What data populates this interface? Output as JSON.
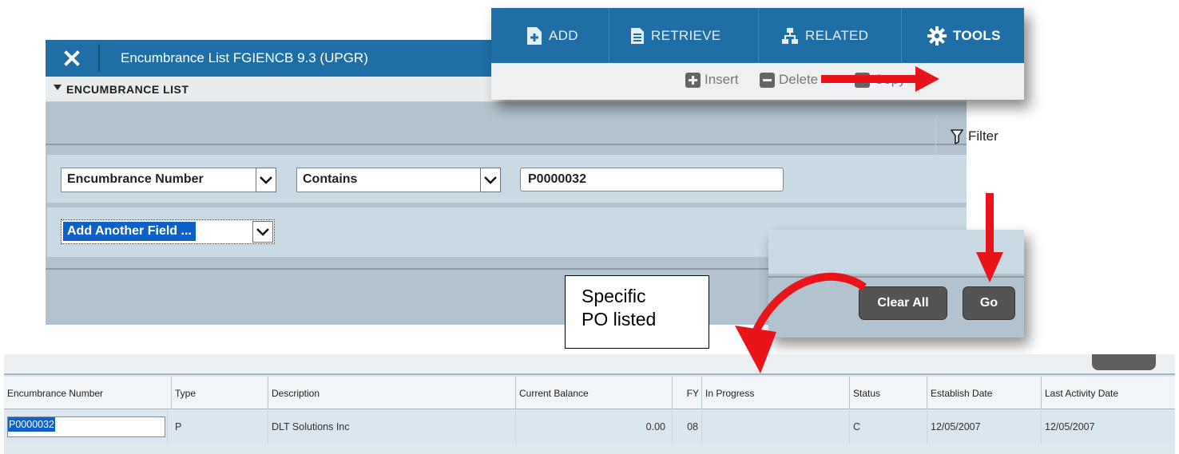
{
  "form": {
    "close_glyph": "✕",
    "title": "Encumbrance List FGIENCB 9.3 (UPGR)",
    "section_title": "ENCUMBRANCE LIST"
  },
  "filter": {
    "field_label": "Encumbrance Number",
    "operator_label": "Contains",
    "value": "P0000032",
    "add_field_label": "Add Another Field ..."
  },
  "toolbar": {
    "add": "ADD",
    "retrieve": "RETRIEVE",
    "related": "RELATED",
    "tools": "TOOLS",
    "insert": "Insert",
    "delete": "Delete",
    "copy": "Copy",
    "filter": "Filter"
  },
  "buttons": {
    "clear_all": "Clear All",
    "go": "Go"
  },
  "callout": {
    "line1": "Specific",
    "line2": "PO listed"
  },
  "results": {
    "columns": [
      "Encumbrance Number",
      "Type",
      "Description",
      "Current Balance",
      "FY",
      "In Progress",
      "Status",
      "Establish Date",
      "Last Activity Date"
    ],
    "row": {
      "encumbrance_number": "P0000032",
      "type": "P",
      "description": "DLT Solutions Inc",
      "current_balance": "0.00",
      "fy": "08",
      "in_progress": "",
      "status": "C",
      "establish_date": "12/05/2007",
      "last_activity_date": "12/05/2007"
    }
  },
  "colors": {
    "banner_blue": "#1f6ea6",
    "panel_gray_blue": "#b2c3cf",
    "row_blue": "#c9dae5",
    "selection_blue": "#1061c5",
    "annotation_red": "#e8141a"
  }
}
